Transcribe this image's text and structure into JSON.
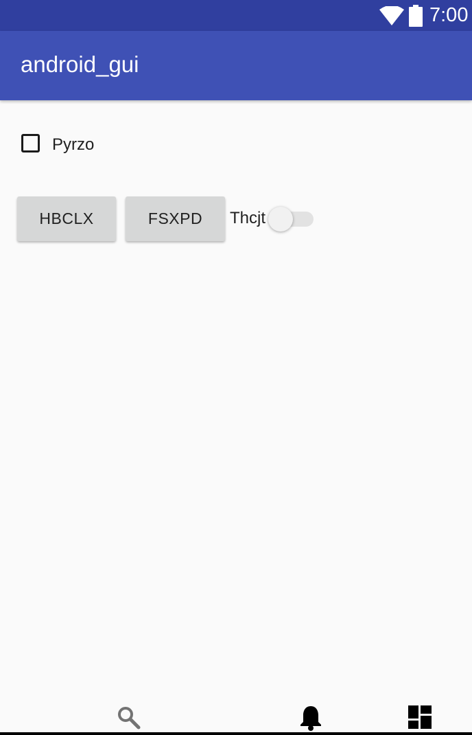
{
  "status_bar": {
    "time": "7:00",
    "icons": [
      "wifi-icon",
      "battery-icon"
    ]
  },
  "app_bar": {
    "title": "android_gui"
  },
  "checkbox": {
    "label": "Pyrzo",
    "checked": false
  },
  "buttons": [
    {
      "label": "HBCLX"
    },
    {
      "label": "FSXPD"
    }
  ],
  "switch": {
    "label": "Thcjt",
    "on": false
  },
  "bottom_nav": {
    "icons": [
      "search-icon",
      "bell-icon",
      "dashboard-icon"
    ]
  },
  "colors": {
    "status_bar": "#303f9f",
    "app_bar": "#3f51b5",
    "background": "#fafafa",
    "button": "#d6d7d7"
  }
}
